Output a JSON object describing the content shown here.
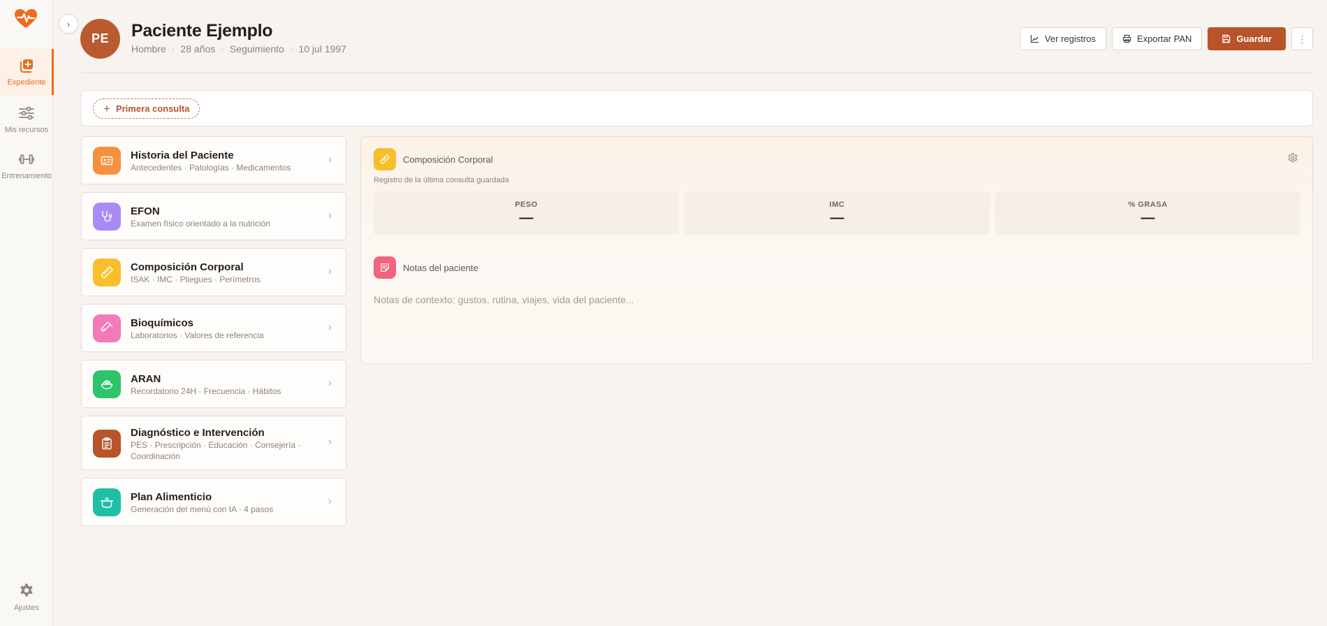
{
  "sidebar": {
    "items": [
      {
        "label": "Expediente",
        "icon": "folder-plus-icon"
      },
      {
        "label": "Mis recursos",
        "icon": "sliders-icon"
      },
      {
        "label": "Entrenamiento",
        "icon": "dumbbell-icon"
      }
    ],
    "settings_label": "Ajustes"
  },
  "patient": {
    "initials": "PE",
    "name": "Paciente Ejemplo",
    "sex": "Hombre",
    "age": "28 años",
    "status": "Seguimiento",
    "birth_date": "10 jul 1997"
  },
  "header": {
    "ver_registros": "Ver registros",
    "exportar_pan": "Exportar PAN",
    "guardar": "Guardar"
  },
  "consult": {
    "first_label": "Primera consulta"
  },
  "modules": [
    {
      "title": "Historia del Paciente",
      "subtitle": "Antecedentes · Patologías · Medicamentos",
      "color": "#f5913e"
    },
    {
      "title": "EFON",
      "subtitle": "Examen físico orientado a la nutrición",
      "color": "#a98bf5"
    },
    {
      "title": "Composición Corporal",
      "subtitle": "ISAK · IMC · Pliegues · Perímetros",
      "color": "#f7bf2a"
    },
    {
      "title": "Bioquímicos",
      "subtitle": "Laboratorios · Valores de referencia",
      "color": "#f27ab8"
    },
    {
      "title": "ARAN",
      "subtitle": "Recordatorio 24H · Frecuencia · Hábitos",
      "color": "#2fc46a"
    },
    {
      "title": "Diagnóstico e Intervención",
      "subtitle": "PES · Prescripción · Educación · Consejería · Coordinación",
      "color": "#b8532a"
    },
    {
      "title": "Plan Alimenticio",
      "subtitle": "Generación del menú con IA · 4 pasos",
      "color": "#1fbfa6"
    }
  ],
  "panel": {
    "composition": {
      "title": "Composición Corporal",
      "caption": "Registro de la última consulta guardada",
      "metrics": [
        {
          "label": "PESO",
          "value": "—"
        },
        {
          "label": "IMC",
          "value": "—"
        },
        {
          "label": "% GRASA",
          "value": "—"
        }
      ]
    },
    "notes": {
      "title": "Notas del paciente",
      "placeholder": "Notas de contexto: gustos, rutina, viajes, vida del paciente..."
    }
  },
  "colors": {
    "accent": "#ea6b1c",
    "primary_button": "#b8532a",
    "avatar": "#b95a30",
    "background": "#f7f3ee"
  }
}
